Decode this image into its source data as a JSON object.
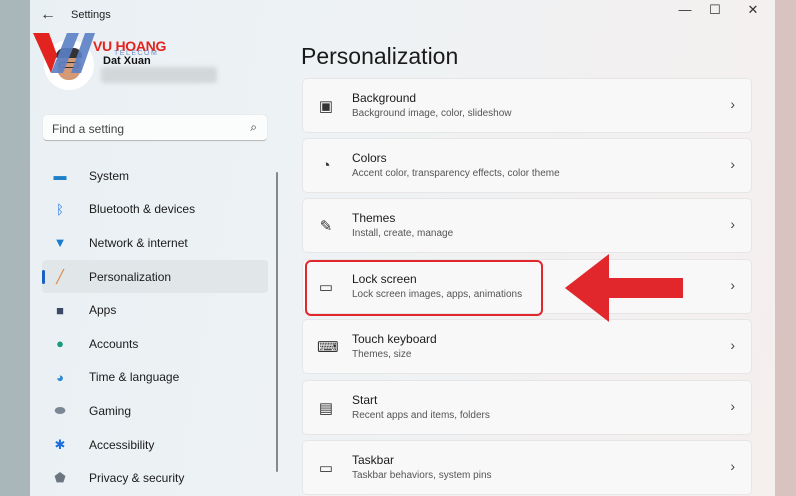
{
  "window": {
    "title": "Settings",
    "minimize": "—",
    "maximize": "☐",
    "close": "✕"
  },
  "watermark": {
    "brand": "VU HOANG",
    "sub": "TELECOM"
  },
  "user": {
    "name": "Dat Xuan"
  },
  "search": {
    "placeholder": "Find a setting"
  },
  "sidebar": {
    "items": [
      {
        "label": "System",
        "icon": "monitor-icon"
      },
      {
        "label": "Bluetooth & devices",
        "icon": "bluetooth-icon"
      },
      {
        "label": "Network & internet",
        "icon": "wifi-icon"
      },
      {
        "label": "Personalization",
        "icon": "brush-icon",
        "active": true
      },
      {
        "label": "Apps",
        "icon": "apps-icon"
      },
      {
        "label": "Accounts",
        "icon": "person-icon"
      },
      {
        "label": "Time & language",
        "icon": "globe-clock-icon"
      },
      {
        "label": "Gaming",
        "icon": "gamepad-icon"
      },
      {
        "label": "Accessibility",
        "icon": "accessibility-icon"
      },
      {
        "label": "Privacy & security",
        "icon": "shield-icon"
      }
    ]
  },
  "main": {
    "title": "Personalization",
    "cards": [
      {
        "title": "Background",
        "subtitle": "Background image, color, slideshow",
        "icon": "image-icon"
      },
      {
        "title": "Colors",
        "subtitle": "Accent color, transparency effects, color theme",
        "icon": "palette-icon"
      },
      {
        "title": "Themes",
        "subtitle": "Install, create, manage",
        "icon": "pen-icon"
      },
      {
        "title": "Lock screen",
        "subtitle": "Lock screen images, apps, animations",
        "icon": "lock-screen-icon",
        "highlighted": true
      },
      {
        "title": "Touch keyboard",
        "subtitle": "Themes, size",
        "icon": "keyboard-icon"
      },
      {
        "title": "Start",
        "subtitle": "Recent apps and items, folders",
        "icon": "start-icon"
      },
      {
        "title": "Taskbar",
        "subtitle": "Taskbar behaviors, system pins",
        "icon": "taskbar-icon"
      }
    ]
  },
  "colors": {
    "accent": "#1a5fc4",
    "highlight": "#e1262c"
  }
}
